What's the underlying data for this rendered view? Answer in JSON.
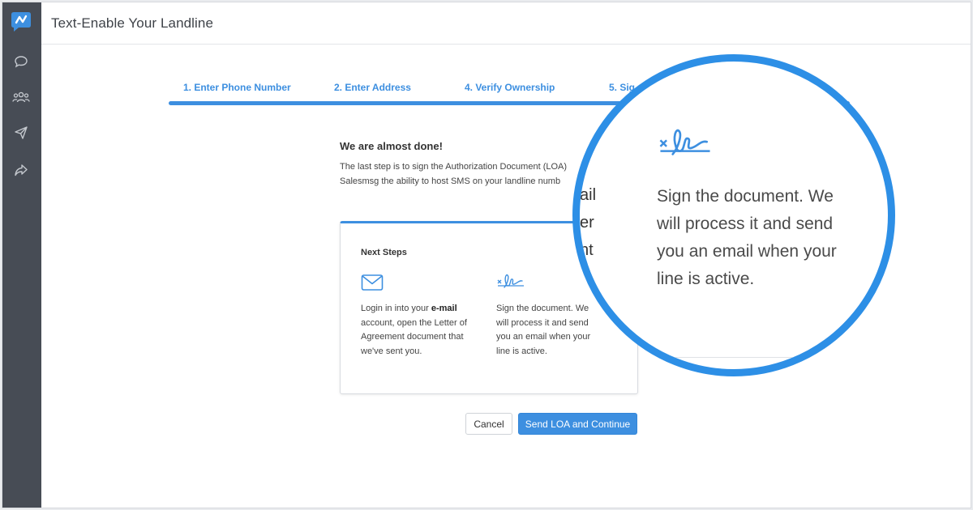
{
  "header": {
    "title": "Text-Enable Your Landline"
  },
  "sidebar": {
    "icons": [
      "chat-icon",
      "users-icon",
      "send-icon",
      "forward-icon"
    ]
  },
  "stepper": {
    "steps": [
      {
        "label": "1. Enter Phone Number"
      },
      {
        "label": "2. Enter Address"
      },
      {
        "label": "4. Verify Ownership"
      },
      {
        "label": "5. Sig"
      }
    ],
    "progress": 1.0
  },
  "main": {
    "heading": "We are almost done!",
    "description_line1": "The last step is to sign the Authorization Document (LOA)",
    "description_line2": "Salesmsg the ability to host SMS on your landline numb"
  },
  "card": {
    "title": "Next Steps",
    "col1": {
      "icon": "envelope-icon",
      "text_before": "Login in into your ",
      "text_bold": "e-mail",
      "text_after": " account, open the Letter of Agreement document that we've sent you."
    },
    "col2": {
      "icon": "signature-icon",
      "line1": "Sign the document. We",
      "line2": "will process it and send",
      "line3": "you an email when your",
      "line4": "line is active."
    }
  },
  "buttons": {
    "cancel": "Cancel",
    "send": "Send LOA and Continue"
  },
  "zoom": {
    "icon": "signature-icon",
    "line1": "Sign the document. We",
    "line2": "will process it and send",
    "line3": "you an email when your",
    "line4": "line is active.",
    "partial1": "ail",
    "partial2": "er",
    "partial3": "nt"
  },
  "colors": {
    "accent": "#3d8fe0",
    "sidebar": "#474c55",
    "zoom_ring": "#2d8fe6"
  }
}
